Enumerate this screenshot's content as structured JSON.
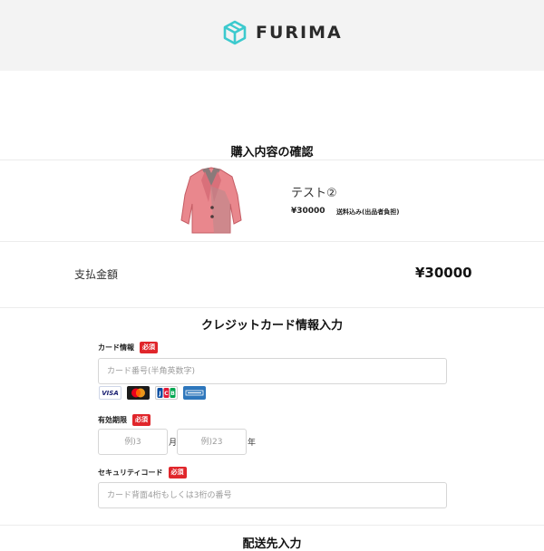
{
  "header": {
    "brand": "FURIMA"
  },
  "confirm": {
    "title": "購入内容の確認"
  },
  "item": {
    "name": "テスト②",
    "price": "¥30000",
    "shipping": "送料込み(出品者負担)"
  },
  "payment": {
    "label": "支払金額",
    "amount": "¥30000"
  },
  "credit": {
    "title": "クレジットカード情報入力",
    "card_label": "カード情報",
    "required": "必須",
    "card_number_placeholder": "カード番号(半角英数字)",
    "card_brands": [
      "VISA",
      "Mastercard",
      "JCB",
      "AMEX"
    ],
    "expiry_label": "有効期限",
    "month_placeholder": "例)3",
    "month_unit": "月",
    "year_placeholder": "例)23",
    "year_unit": "年",
    "cvc_label": "セキュリティコード",
    "cvc_placeholder": "カード背面4桁もしくは3桁の番号"
  },
  "shipping": {
    "title": "配送先入力"
  },
  "colors": {
    "accent": "#3ccace",
    "required": "#e0262b",
    "header_bg": "#f3f3f3"
  }
}
